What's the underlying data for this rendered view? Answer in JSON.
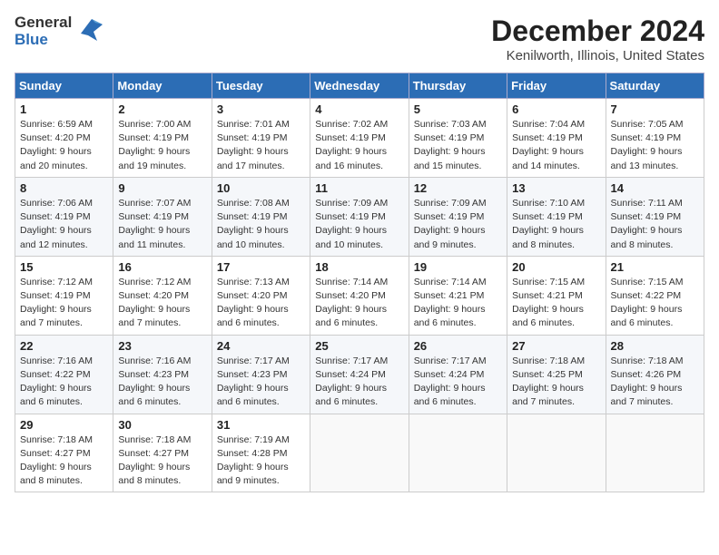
{
  "header": {
    "logo_general": "General",
    "logo_blue": "Blue",
    "title": "December 2024",
    "subtitle": "Kenilworth, Illinois, United States"
  },
  "calendar": {
    "days_of_week": [
      "Sunday",
      "Monday",
      "Tuesday",
      "Wednesday",
      "Thursday",
      "Friday",
      "Saturday"
    ],
    "weeks": [
      [
        {
          "day": "1",
          "info": "Sunrise: 6:59 AM\nSunset: 4:20 PM\nDaylight: 9 hours\nand 20 minutes."
        },
        {
          "day": "2",
          "info": "Sunrise: 7:00 AM\nSunset: 4:19 PM\nDaylight: 9 hours\nand 19 minutes."
        },
        {
          "day": "3",
          "info": "Sunrise: 7:01 AM\nSunset: 4:19 PM\nDaylight: 9 hours\nand 17 minutes."
        },
        {
          "day": "4",
          "info": "Sunrise: 7:02 AM\nSunset: 4:19 PM\nDaylight: 9 hours\nand 16 minutes."
        },
        {
          "day": "5",
          "info": "Sunrise: 7:03 AM\nSunset: 4:19 PM\nDaylight: 9 hours\nand 15 minutes."
        },
        {
          "day": "6",
          "info": "Sunrise: 7:04 AM\nSunset: 4:19 PM\nDaylight: 9 hours\nand 14 minutes."
        },
        {
          "day": "7",
          "info": "Sunrise: 7:05 AM\nSunset: 4:19 PM\nDaylight: 9 hours\nand 13 minutes."
        }
      ],
      [
        {
          "day": "8",
          "info": "Sunrise: 7:06 AM\nSunset: 4:19 PM\nDaylight: 9 hours\nand 12 minutes."
        },
        {
          "day": "9",
          "info": "Sunrise: 7:07 AM\nSunset: 4:19 PM\nDaylight: 9 hours\nand 11 minutes."
        },
        {
          "day": "10",
          "info": "Sunrise: 7:08 AM\nSunset: 4:19 PM\nDaylight: 9 hours\nand 10 minutes."
        },
        {
          "day": "11",
          "info": "Sunrise: 7:09 AM\nSunset: 4:19 PM\nDaylight: 9 hours\nand 10 minutes."
        },
        {
          "day": "12",
          "info": "Sunrise: 7:09 AM\nSunset: 4:19 PM\nDaylight: 9 hours\nand 9 minutes."
        },
        {
          "day": "13",
          "info": "Sunrise: 7:10 AM\nSunset: 4:19 PM\nDaylight: 9 hours\nand 8 minutes."
        },
        {
          "day": "14",
          "info": "Sunrise: 7:11 AM\nSunset: 4:19 PM\nDaylight: 9 hours\nand 8 minutes."
        }
      ],
      [
        {
          "day": "15",
          "info": "Sunrise: 7:12 AM\nSunset: 4:19 PM\nDaylight: 9 hours\nand 7 minutes."
        },
        {
          "day": "16",
          "info": "Sunrise: 7:12 AM\nSunset: 4:20 PM\nDaylight: 9 hours\nand 7 minutes."
        },
        {
          "day": "17",
          "info": "Sunrise: 7:13 AM\nSunset: 4:20 PM\nDaylight: 9 hours\nand 6 minutes."
        },
        {
          "day": "18",
          "info": "Sunrise: 7:14 AM\nSunset: 4:20 PM\nDaylight: 9 hours\nand 6 minutes."
        },
        {
          "day": "19",
          "info": "Sunrise: 7:14 AM\nSunset: 4:21 PM\nDaylight: 9 hours\nand 6 minutes."
        },
        {
          "day": "20",
          "info": "Sunrise: 7:15 AM\nSunset: 4:21 PM\nDaylight: 9 hours\nand 6 minutes."
        },
        {
          "day": "21",
          "info": "Sunrise: 7:15 AM\nSunset: 4:22 PM\nDaylight: 9 hours\nand 6 minutes."
        }
      ],
      [
        {
          "day": "22",
          "info": "Sunrise: 7:16 AM\nSunset: 4:22 PM\nDaylight: 9 hours\nand 6 minutes."
        },
        {
          "day": "23",
          "info": "Sunrise: 7:16 AM\nSunset: 4:23 PM\nDaylight: 9 hours\nand 6 minutes."
        },
        {
          "day": "24",
          "info": "Sunrise: 7:17 AM\nSunset: 4:23 PM\nDaylight: 9 hours\nand 6 minutes."
        },
        {
          "day": "25",
          "info": "Sunrise: 7:17 AM\nSunset: 4:24 PM\nDaylight: 9 hours\nand 6 minutes."
        },
        {
          "day": "26",
          "info": "Sunrise: 7:17 AM\nSunset: 4:24 PM\nDaylight: 9 hours\nand 6 minutes."
        },
        {
          "day": "27",
          "info": "Sunrise: 7:18 AM\nSunset: 4:25 PM\nDaylight: 9 hours\nand 7 minutes."
        },
        {
          "day": "28",
          "info": "Sunrise: 7:18 AM\nSunset: 4:26 PM\nDaylight: 9 hours\nand 7 minutes."
        }
      ],
      [
        {
          "day": "29",
          "info": "Sunrise: 7:18 AM\nSunset: 4:27 PM\nDaylight: 9 hours\nand 8 minutes."
        },
        {
          "day": "30",
          "info": "Sunrise: 7:18 AM\nSunset: 4:27 PM\nDaylight: 9 hours\nand 8 minutes."
        },
        {
          "day": "31",
          "info": "Sunrise: 7:19 AM\nSunset: 4:28 PM\nDaylight: 9 hours\nand 9 minutes."
        },
        {
          "day": "",
          "info": ""
        },
        {
          "day": "",
          "info": ""
        },
        {
          "day": "",
          "info": ""
        },
        {
          "day": "",
          "info": ""
        }
      ]
    ]
  }
}
